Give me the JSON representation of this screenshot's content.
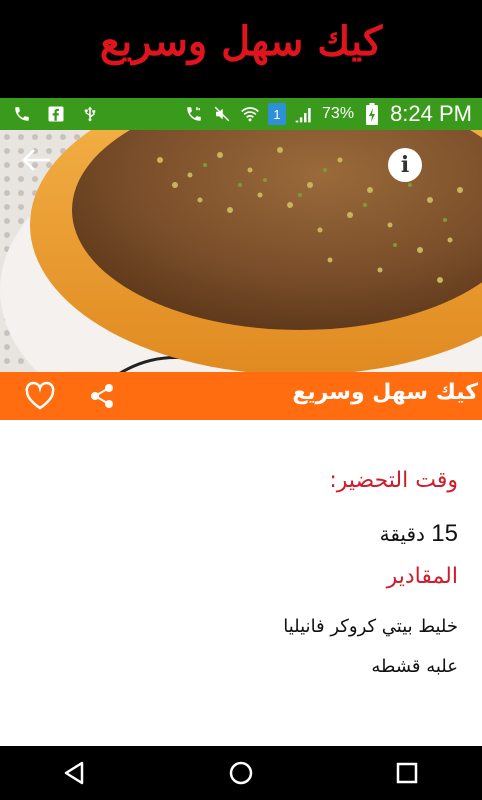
{
  "banner": {
    "title": "كيك سهل وسريع"
  },
  "status_bar": {
    "battery_percent": "73%",
    "sim_badge": "1",
    "time": "8:24 PM",
    "icons": [
      "phone-icon",
      "facebook-icon",
      "usb-icon",
      "call-forward-icon",
      "mute-icon",
      "wifi-icon",
      "sim-icon",
      "signal-icon",
      "battery-charging-icon"
    ]
  },
  "recipe": {
    "title": "كيك سهل وسريع",
    "prep_label": "وقت التحضير:",
    "prep_time_number": "15",
    "prep_time_unit": "دقيقة",
    "ingredients_label": "المقادير",
    "ingredients": [
      "خليط بيتي كروكر فانيليا",
      "علبه قشطه"
    ]
  },
  "colors": {
    "banner_text": "#e0141c",
    "status_bar": "#3a9a1c",
    "action_bar": "#ff6d10",
    "section_label": "#d01c2c"
  }
}
